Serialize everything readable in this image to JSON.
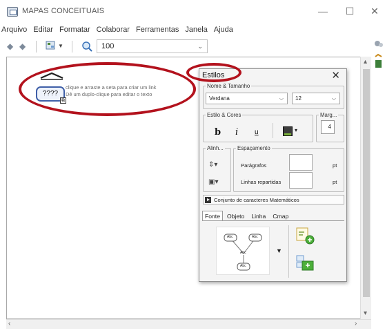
{
  "window": {
    "title": "MAPAS CONCEITUAIS",
    "minimize": "—",
    "maximize": "☐",
    "close": "✕"
  },
  "menu": [
    "Arquivo",
    "Editar",
    "Formatar",
    "Colaborar",
    "Ferramentas",
    "Janela",
    "Ajuda"
  ],
  "toolbar": {
    "zoom_value": "100"
  },
  "canvas": {
    "concept_text": "????",
    "hint_line1": "clique e arraste a seta para criar um link",
    "hint_line2": "Dê um duplo-clique para editar o texto"
  },
  "styles": {
    "title": "Estilos",
    "close": "✕",
    "font_group": "Nome & Tamanho",
    "font_name": "Verdana",
    "font_size": "12",
    "style_group": "Estilo & Cores",
    "bold": "b",
    "italic": "i",
    "underline": "u",
    "margin_group": "Marg...",
    "margin_value": "4",
    "align_group": "Alinh...",
    "spacing_group": "Espaçamento",
    "paragraphs_label": "Parágrafos",
    "lines_label": "Linhas repartidas",
    "unit": "pt",
    "math_label": "Conjunto de caracteres Matemáticos",
    "tabs": [
      "Fonte",
      "Objeto",
      "Linha",
      "Cmap"
    ],
    "active_tab": "Fonte",
    "node_label": "Abc"
  },
  "colors": {
    "annotation": "#b3121d",
    "concept_border": "#3f5fa8",
    "accent_green": "#4caf3a"
  }
}
